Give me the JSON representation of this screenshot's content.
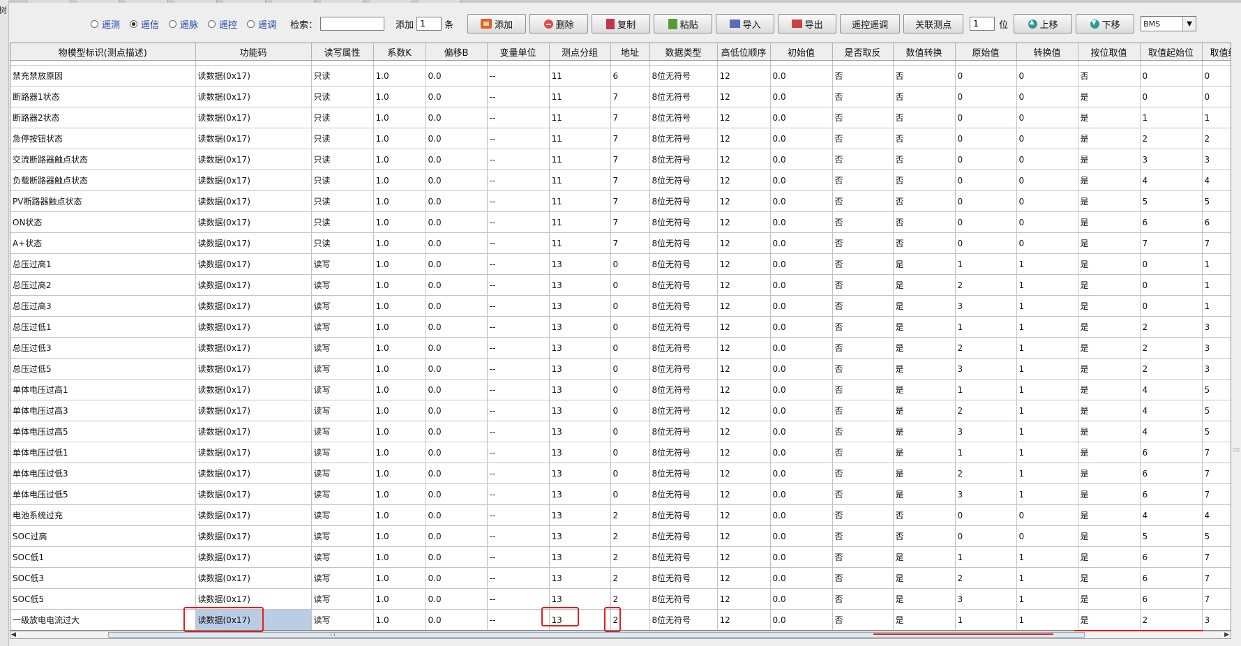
{
  "left_tab": "树",
  "toolbar": {
    "radios": [
      {
        "label": "遥测",
        "checked": false
      },
      {
        "label": "遥信",
        "checked": true
      },
      {
        "label": "遥脉",
        "checked": false
      },
      {
        "label": "遥控",
        "checked": false
      },
      {
        "label": "遥调",
        "checked": false
      }
    ],
    "search_label": "检索：",
    "search_value": "",
    "add_label": "添加",
    "add_count": "1",
    "add_unit": "条",
    "buttons": {
      "add": "添加",
      "delete": "删除",
      "copy": "复制",
      "paste": "粘贴",
      "import": "导入",
      "export": "导出",
      "remote_adjust": "遥控遥调",
      "link_point": "关联测点"
    },
    "pos_value": "1",
    "pos_unit": "位",
    "move_up": "上移",
    "move_down": "下移",
    "bms_select": "BMS"
  },
  "table": {
    "columns": [
      "物模型标识(测点描述)",
      "功能码",
      "读写属性",
      "系数K",
      "偏移B",
      "变量单位",
      "测点分组",
      "地址",
      "数据类型",
      "高低位顺序",
      "初始值",
      "是否取反",
      "数值转换",
      "原始值",
      "转换值",
      "按位取值",
      "取值起始位",
      "取值终"
    ],
    "rows": [
      [
        "禁充禁放原因",
        "读数据(0x17)",
        "只读",
        "1.0",
        "0.0",
        "--",
        "11",
        "6",
        "8位无符号",
        "12",
        "0.0",
        "否",
        "否",
        "0",
        "0",
        "否",
        "0",
        "0"
      ],
      [
        "断路器1状态",
        "读数据(0x17)",
        "只读",
        "1.0",
        "0.0",
        "--",
        "11",
        "7",
        "8位无符号",
        "12",
        "0.0",
        "否",
        "否",
        "0",
        "0",
        "是",
        "0",
        "0"
      ],
      [
        "断路器2状态",
        "读数据(0x17)",
        "只读",
        "1.0",
        "0.0",
        "--",
        "11",
        "7",
        "8位无符号",
        "12",
        "0.0",
        "否",
        "否",
        "0",
        "0",
        "是",
        "1",
        "1"
      ],
      [
        "急停按钮状态",
        "读数据(0x17)",
        "只读",
        "1.0",
        "0.0",
        "--",
        "11",
        "7",
        "8位无符号",
        "12",
        "0.0",
        "否",
        "否",
        "0",
        "0",
        "是",
        "2",
        "2"
      ],
      [
        "交流断路器触点状态",
        "读数据(0x17)",
        "只读",
        "1.0",
        "0.0",
        "--",
        "11",
        "7",
        "8位无符号",
        "12",
        "0.0",
        "否",
        "否",
        "0",
        "0",
        "是",
        "3",
        "3"
      ],
      [
        "负载断路器触点状态",
        "读数据(0x17)",
        "只读",
        "1.0",
        "0.0",
        "--",
        "11",
        "7",
        "8位无符号",
        "12",
        "0.0",
        "否",
        "否",
        "0",
        "0",
        "是",
        "4",
        "4"
      ],
      [
        "PV断路器触点状态",
        "读数据(0x17)",
        "只读",
        "1.0",
        "0.0",
        "--",
        "11",
        "7",
        "8位无符号",
        "12",
        "0.0",
        "否",
        "否",
        "0",
        "0",
        "是",
        "5",
        "5"
      ],
      [
        "ON状态",
        "读数据(0x17)",
        "只读",
        "1.0",
        "0.0",
        "--",
        "11",
        "7",
        "8位无符号",
        "12",
        "0.0",
        "否",
        "否",
        "0",
        "0",
        "是",
        "6",
        "6"
      ],
      [
        "A+状态",
        "读数据(0x17)",
        "只读",
        "1.0",
        "0.0",
        "--",
        "11",
        "7",
        "8位无符号",
        "12",
        "0.0",
        "否",
        "否",
        "0",
        "0",
        "是",
        "7",
        "7"
      ],
      [
        "总压过高1",
        "读数据(0x17)",
        "读写",
        "1.0",
        "0.0",
        "--",
        "13",
        "0",
        "8位无符号",
        "12",
        "0.0",
        "否",
        "是",
        "1",
        "1",
        "是",
        "0",
        "1"
      ],
      [
        "总压过高2",
        "读数据(0x17)",
        "读写",
        "1.0",
        "0.0",
        "--",
        "13",
        "0",
        "8位无符号",
        "12",
        "0.0",
        "否",
        "是",
        "2",
        "1",
        "是",
        "0",
        "1"
      ],
      [
        "总压过高3",
        "读数据(0x17)",
        "读写",
        "1.0",
        "0.0",
        "--",
        "13",
        "0",
        "8位无符号",
        "12",
        "0.0",
        "否",
        "是",
        "3",
        "1",
        "是",
        "0",
        "1"
      ],
      [
        "总压过低1",
        "读数据(0x17)",
        "读写",
        "1.0",
        "0.0",
        "--",
        "13",
        "0",
        "8位无符号",
        "12",
        "0.0",
        "否",
        "是",
        "1",
        "1",
        "是",
        "2",
        "3"
      ],
      [
        "总压过低3",
        "读数据(0x17)",
        "读写",
        "1.0",
        "0.0",
        "--",
        "13",
        "0",
        "8位无符号",
        "12",
        "0.0",
        "否",
        "是",
        "2",
        "1",
        "是",
        "2",
        "3"
      ],
      [
        "总压过低5",
        "读数据(0x17)",
        "读写",
        "1.0",
        "0.0",
        "--",
        "13",
        "0",
        "8位无符号",
        "12",
        "0.0",
        "否",
        "是",
        "3",
        "1",
        "是",
        "2",
        "3"
      ],
      [
        "单体电压过高1",
        "读数据(0x17)",
        "读写",
        "1.0",
        "0.0",
        "--",
        "13",
        "0",
        "8位无符号",
        "12",
        "0.0",
        "否",
        "是",
        "1",
        "1",
        "是",
        "4",
        "5"
      ],
      [
        "单体电压过高3",
        "读数据(0x17)",
        "读写",
        "1.0",
        "0.0",
        "--",
        "13",
        "0",
        "8位无符号",
        "12",
        "0.0",
        "否",
        "是",
        "2",
        "1",
        "是",
        "4",
        "5"
      ],
      [
        "单体电压过高5",
        "读数据(0x17)",
        "读写",
        "1.0",
        "0.0",
        "--",
        "13",
        "0",
        "8位无符号",
        "12",
        "0.0",
        "否",
        "是",
        "3",
        "1",
        "是",
        "4",
        "5"
      ],
      [
        "单体电压过低1",
        "读数据(0x17)",
        "读写",
        "1.0",
        "0.0",
        "--",
        "13",
        "0",
        "8位无符号",
        "12",
        "0.0",
        "否",
        "是",
        "1",
        "1",
        "是",
        "6",
        "7"
      ],
      [
        "单体电压过低3",
        "读数据(0x17)",
        "读写",
        "1.0",
        "0.0",
        "--",
        "13",
        "0",
        "8位无符号",
        "12",
        "0.0",
        "否",
        "是",
        "2",
        "1",
        "是",
        "6",
        "7"
      ],
      [
        "单体电压过低5",
        "读数据(0x17)",
        "读写",
        "1.0",
        "0.0",
        "--",
        "13",
        "0",
        "8位无符号",
        "12",
        "0.0",
        "否",
        "是",
        "3",
        "1",
        "是",
        "6",
        "7"
      ],
      [
        "电池系统过充",
        "读数据(0x17)",
        "读写",
        "1.0",
        "0.0",
        "--",
        "13",
        "2",
        "8位无符号",
        "12",
        "0.0",
        "否",
        "否",
        "0",
        "0",
        "是",
        "4",
        "4"
      ],
      [
        "SOC过高",
        "读数据(0x17)",
        "读写",
        "1.0",
        "0.0",
        "--",
        "13",
        "2",
        "8位无符号",
        "12",
        "0.0",
        "否",
        "否",
        "0",
        "0",
        "是",
        "5",
        "5"
      ],
      [
        "SOC低1",
        "读数据(0x17)",
        "读写",
        "1.0",
        "0.0",
        "--",
        "13",
        "2",
        "8位无符号",
        "12",
        "0.0",
        "否",
        "是",
        "1",
        "1",
        "是",
        "6",
        "7"
      ],
      [
        "SOC低3",
        "读数据(0x17)",
        "读写",
        "1.0",
        "0.0",
        "--",
        "13",
        "2",
        "8位无符号",
        "12",
        "0.0",
        "否",
        "是",
        "2",
        "1",
        "是",
        "6",
        "7"
      ],
      [
        "SOC低5",
        "读数据(0x17)",
        "读写",
        "1.0",
        "0.0",
        "--",
        "13",
        "2",
        "8位无符号",
        "12",
        "0.0",
        "否",
        "是",
        "3",
        "1",
        "是",
        "6",
        "7"
      ],
      [
        "一级放电电流过大",
        "读数据(0x17)",
        "读写",
        "1.0",
        "0.0",
        "--",
        "13",
        "2",
        "8位无符号",
        "12",
        "0.0",
        "否",
        "是",
        "1",
        "1",
        "是",
        "2",
        "3"
      ]
    ]
  }
}
